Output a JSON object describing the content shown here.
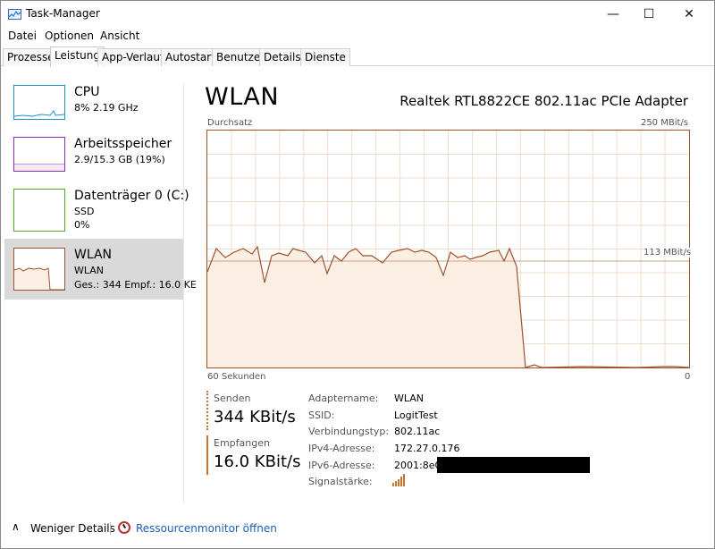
{
  "window": {
    "title": "Task-Manager",
    "minimize_glyph": "—",
    "maximize_glyph": "☐",
    "close_glyph": "✕"
  },
  "menu": [
    "Datei",
    "Optionen",
    "Ansicht"
  ],
  "tabs": [
    "Prozesse",
    "Leistung",
    "App-Verlauf",
    "Autostart",
    "Benutzer",
    "Details",
    "Dienste"
  ],
  "active_tab": "Leistung",
  "sidebar": {
    "items": [
      {
        "title": "CPU",
        "line1": "8%  2.19 GHz",
        "line2": "",
        "color": "#1e90c8"
      },
      {
        "title": "Arbeitsspeicher",
        "line1": "2.9/15.3 GB (19%)",
        "line2": "",
        "color": "#8b2db5"
      },
      {
        "title": "Datenträger 0 (C:)",
        "line1": "SSD",
        "line2": "0%",
        "color": "#4caf1e"
      },
      {
        "title": "WLAN",
        "line1": "WLAN",
        "line2": "Ges.: 344  Empf.: 16.0 KE",
        "color": "#a0522d"
      }
    ],
    "selected": "WLAN"
  },
  "main": {
    "title": "WLAN",
    "adapter": "Realtek RTL8822CE 802.11ac PCIe Adapter",
    "graph": {
      "top_left_label": "Durchsatz",
      "top_right_label": "250 MBit/s",
      "mid_label": "113 MBit/s",
      "bottom_left_label": "60 Sekunden",
      "bottom_right_label": "0",
      "line_color": "#a0522d",
      "fill_color": "#fbeee2"
    },
    "send": {
      "label": "Senden",
      "value": "344 KBit/s"
    },
    "receive": {
      "label": "Empfangen",
      "value": "16.0 KBit/s"
    },
    "info": [
      {
        "key": "Adaptername:",
        "value": "WLAN"
      },
      {
        "key": "SSID:",
        "value": "LogitTest"
      },
      {
        "key": "Verbindungstyp:",
        "value": "802.11ac"
      },
      {
        "key": "IPv4-Adresse:",
        "value": "172.27.0.176"
      },
      {
        "key": "IPv6-Adresse:",
        "value": "2001:8e0:"
      },
      {
        "key": "Signalstärke:",
        "value": ""
      }
    ]
  },
  "footer": {
    "fewer_details": "Weniger Details",
    "resource_monitor": "Ressourcenmonitor öffnen",
    "chevron": "∧"
  }
}
